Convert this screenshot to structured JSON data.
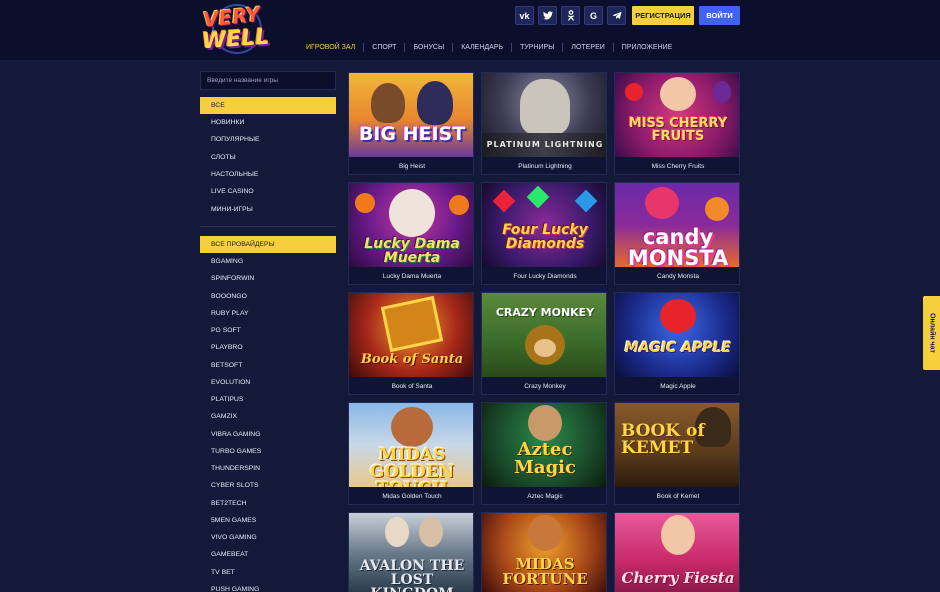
{
  "brand": {
    "logo_line1": "VERY",
    "logo_line2": "WELL"
  },
  "header": {
    "social": [
      {
        "icon": "vk-icon",
        "glyph": "vk"
      },
      {
        "icon": "twitter-icon",
        "glyph": "t"
      },
      {
        "icon": "odnoklassniki-icon",
        "glyph": "ok"
      },
      {
        "icon": "google-icon",
        "glyph": "G"
      },
      {
        "icon": "telegram-icon",
        "glyph": "➤"
      }
    ],
    "register_label": "РЕГИСТРАЦИЯ",
    "login_label": "ВОЙТИ"
  },
  "nav": [
    {
      "label": "ИГРОВОЙ ЗАЛ",
      "active": true
    },
    {
      "label": "СПОРТ"
    },
    {
      "label": "БОНУСЫ"
    },
    {
      "label": "КАЛЕНДАРЬ"
    },
    {
      "label": "ТУРНИРЫ"
    },
    {
      "label": "ЛОТЕРЕИ"
    },
    {
      "label": "ПРИЛОЖЕНИЕ"
    }
  ],
  "sidebar": {
    "search_placeholder": "Введите название игры",
    "categories": [
      "ВСЕ",
      "НОВИНКИ",
      "ПОПУЛЯРНЫЕ",
      "СЛОТЫ",
      "НАСТОЛЬНЫЕ",
      "LIVE CASINO",
      "МИНИ-ИГРЫ"
    ],
    "providers": [
      "ВСЕ ПРОВАЙДЕРЫ",
      "BGAMING",
      "SPINFORWIN",
      "BOOONGO",
      "RUBY PLAY",
      "PG SOFT",
      "PLAYBRO",
      "BETSOFT",
      "EVOLUTION",
      "PLATIPUS",
      "GAMZIX",
      "VIBRA GAMING",
      "TURBO GAMES",
      "THUNDERSPIN",
      "CYBER SLOTS",
      "BET2TECH",
      "5MEN GAMES",
      "VIVO GAMING",
      "GAMEBEAT",
      "TV BET",
      "PUSH GAMING"
    ]
  },
  "games": [
    {
      "title": "Big Heist",
      "logo": "BIG HEIST"
    },
    {
      "title": "Platinum Lightning",
      "logo": "PLATINUM LIGHTNING"
    },
    {
      "title": "Miss Cherry Fruits",
      "logo": "MISS CHERRY FRUITS"
    },
    {
      "title": "Lucky Dama Muerta",
      "logo": "Lucky Dama Muerta"
    },
    {
      "title": "Four Lucky Diamonds",
      "logo": "Four Lucky Diamonds"
    },
    {
      "title": "Candy Monsta",
      "logo": "candy MONSTA"
    },
    {
      "title": "Book of Santa",
      "logo": "Book of Santa"
    },
    {
      "title": "Crazy Monkey",
      "logo": "CRAZY MONKEY"
    },
    {
      "title": "Magic Apple",
      "logo": "MAGIC APPLE"
    },
    {
      "title": "Midas Golden Touch",
      "logo": "MIDAS GOLDEN TOUCH"
    },
    {
      "title": "Aztec Magic",
      "logo": "Aztec Magic"
    },
    {
      "title": "Book of Kemet",
      "logo": "BOOK of KEMET"
    },
    {
      "title": "",
      "logo": "AVALON THE LOST KINGDOM"
    },
    {
      "title": "",
      "logo": "MIDAS FORTUNE"
    },
    {
      "title": "",
      "logo": "Cherry Fiesta"
    }
  ],
  "chat": {
    "label": "Онлайн чат"
  },
  "colors": {
    "accent": "#f5d03c",
    "primary": "#3f63ea",
    "bg": "#14193a",
    "header_bg": "#0b0f2c"
  }
}
